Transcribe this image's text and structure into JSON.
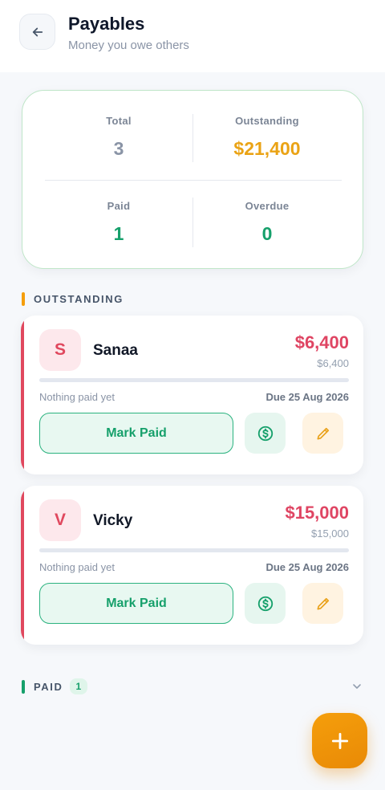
{
  "header": {
    "title": "Payables",
    "subtitle": "Money you owe others"
  },
  "summary": {
    "total_label": "Total",
    "total_value": "3",
    "outstanding_label": "Outstanding",
    "outstanding_value": "$21,400",
    "paid_label": "Paid",
    "paid_value": "1",
    "overdue_label": "Overdue",
    "overdue_value": "0"
  },
  "sections": {
    "outstanding_title": "OUTSTANDING",
    "paid_title": "PAID",
    "paid_count": "1"
  },
  "payables": [
    {
      "initial": "S",
      "name": "Sanaa",
      "amount": "$6,400",
      "remaining": "$6,400",
      "paid_fraction": 0,
      "paid_note": "Nothing paid yet",
      "due": "Due 25 Aug 2026",
      "mark_paid_label": "Mark Paid"
    },
    {
      "initial": "V",
      "name": "Vicky",
      "amount": "$15,000",
      "remaining": "$15,000",
      "paid_fraction": 0,
      "paid_note": "Nothing paid yet",
      "due": "Due 25 Aug 2026",
      "mark_paid_label": "Mark Paid"
    }
  ],
  "icons": {
    "back": "arrow-left-icon",
    "pay": "dollar-circle-icon",
    "edit": "pencil-icon",
    "expand": "chevron-down-icon",
    "add": "plus-icon"
  },
  "colors": {
    "accent": "#f59e0b",
    "success": "#16a06b",
    "danger": "#df4563",
    "muted": "#8a94a6"
  }
}
